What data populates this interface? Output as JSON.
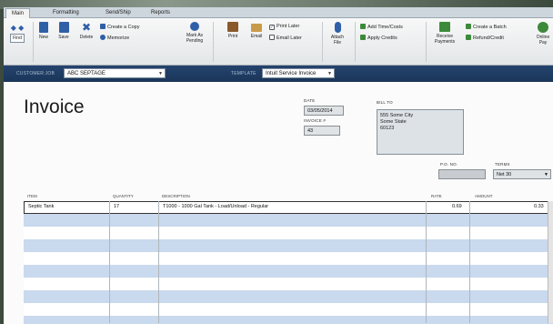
{
  "tabs": [
    "Main",
    "Formatting",
    "Send/Ship",
    "Reports"
  ],
  "ribbon": {
    "find": "Find",
    "new": "New",
    "save": "Save",
    "delete": "Delete",
    "create_copy": "Create a Copy",
    "memorize": "Memorize",
    "mark_pending": "Mark As Pending",
    "print": "Print",
    "email": "Email",
    "print_later": "Print Later",
    "email_later": "Email Later",
    "attach_file": "Attach File",
    "add_time_costs": "Add Time/Costs",
    "apply_credits": "Apply Credits",
    "receive_payments": "Receive Payments",
    "create_batch": "Create a Batch",
    "refund_credit": "Refund/Credit",
    "online_pay": "Online Pay"
  },
  "customer_bar": {
    "customer_label": "CUSTOMER:JOB",
    "customer_value": "ABC SEPTAGE",
    "template_label": "TEMPLATE",
    "template_value": "Intuit Service Invoice"
  },
  "form": {
    "title": "Invoice",
    "date_label": "DATE",
    "date_value": "03/05/2014",
    "invoice_label": "INVOICE #",
    "invoice_value": "43",
    "billto_label": "BILL TO",
    "billto_lines": [
      "555 Some City",
      "Some State",
      "60123"
    ],
    "po_label": "P.O. NO.",
    "po_value": "",
    "terms_label": "TERMS",
    "terms_value": "Net 30"
  },
  "table": {
    "headers": [
      "ITEM",
      "QUANTITY",
      "DESCRIPTION",
      "RATE",
      "AMOUNT"
    ],
    "rows": [
      [
        "Septic Tank",
        "17",
        "T1000 - 1000 Gal Tank - Load/Unload - Regular",
        "0.69",
        "0.33"
      ]
    ]
  },
  "colors": {
    "customer_bar": "#1f3d66",
    "row_stripe": "#c9d9ee",
    "ribbon_blue": "#2f5fa7",
    "ribbon_green": "#3c8a3a"
  }
}
